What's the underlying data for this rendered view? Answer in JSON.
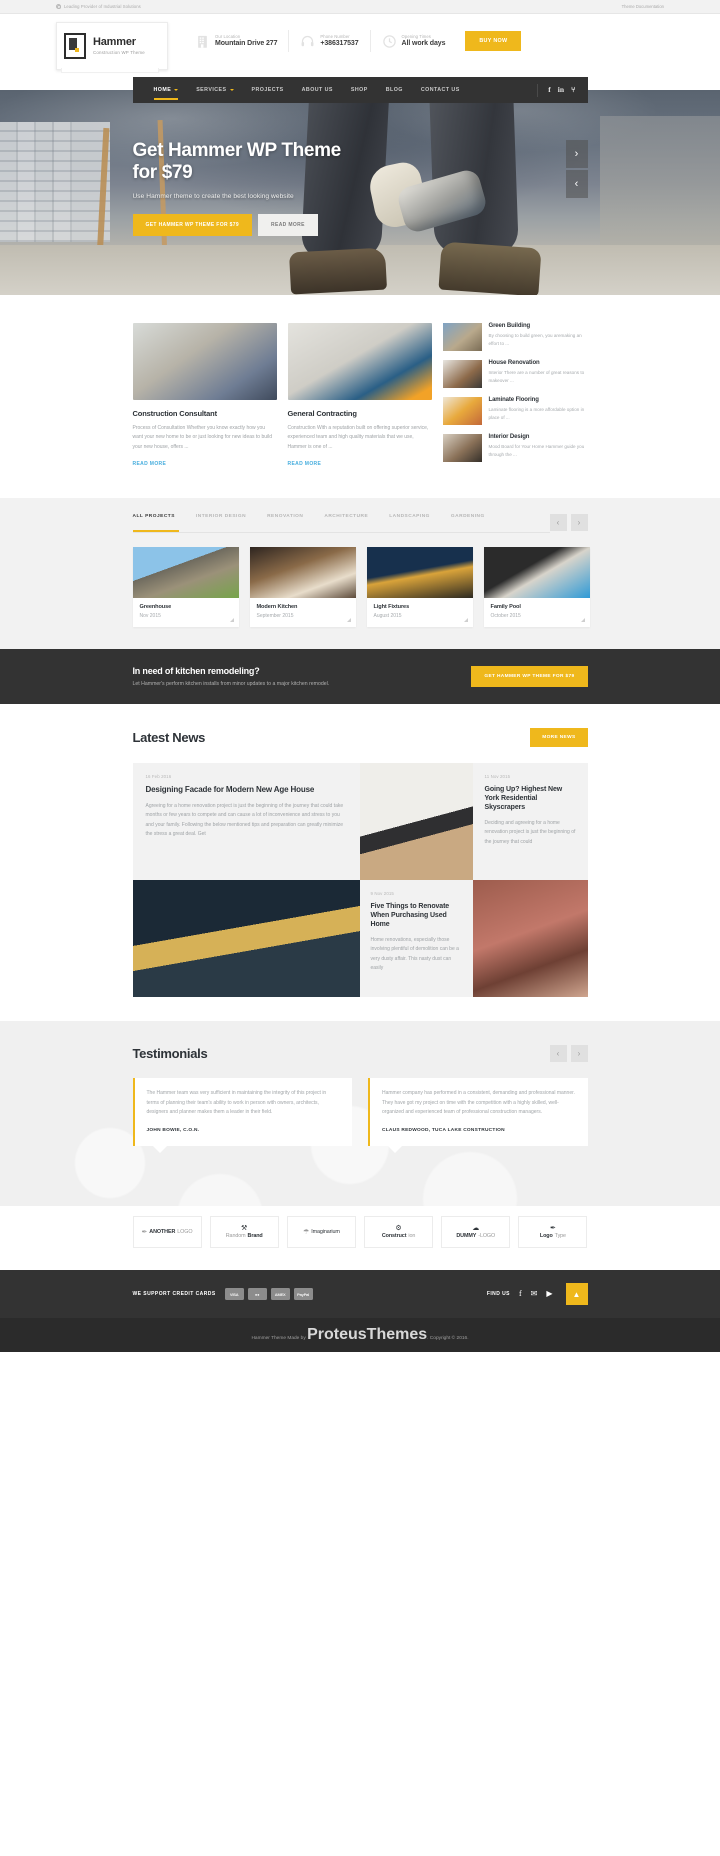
{
  "topbar": {
    "tagline": "Leading Provider of Industrial Solutions",
    "doc_link": "Theme Documentation"
  },
  "header": {
    "brand": "Hammer",
    "brand_sub": "Construction WP Theme",
    "info": [
      {
        "label": "Our Location",
        "value": "Mountain Drive 277",
        "icon": "building-icon"
      },
      {
        "label": "Phone Number",
        "value": "+386317537",
        "icon": "headset-icon"
      },
      {
        "label": "Opening Times",
        "value": "All work days",
        "icon": "clock-icon"
      }
    ],
    "buy_label": "BUY NOW"
  },
  "nav": {
    "items": [
      {
        "label": "HOME",
        "active": true,
        "caret": true
      },
      {
        "label": "SERVICES",
        "active": false,
        "caret": true
      },
      {
        "label": "PROJECTS",
        "active": false,
        "caret": false
      },
      {
        "label": "ABOUT US",
        "active": false,
        "caret": false
      },
      {
        "label": "SHOP",
        "active": false,
        "caret": false
      },
      {
        "label": "BLOG",
        "active": false,
        "caret": false
      },
      {
        "label": "CONTACT US",
        "active": false,
        "caret": false
      }
    ],
    "social": [
      "f",
      "in",
      "⑂"
    ]
  },
  "hero": {
    "title_line1": "Get Hammer WP Theme",
    "title_line2": "for $79",
    "subtitle": "Use Hammer theme to create the best looking website",
    "btn_primary": "GET HAMMER WP THEME FOR $79",
    "btn_secondary": "READ MORE",
    "next": "›",
    "prev": "‹"
  },
  "services": {
    "cards": [
      {
        "title": "Construction Consultant",
        "text": "Process of Consultation Whether you know exactly how you want your new home to be or just looking for new ideas to build your new house, offers ...",
        "more": "READ MORE"
      },
      {
        "title": "General Contracting",
        "text": "Construction With a reputation built on offering superior service, experienced team and high quality materials that we use, Hammer is one of ...",
        "more": "READ MORE"
      }
    ],
    "list": [
      {
        "title": "Green Building",
        "text": "By choosing to build green, you aremaking an effort to ..."
      },
      {
        "title": "House Renovation",
        "text": "Interior There are a number of great reasons to makeover ..."
      },
      {
        "title": "Laminate Flooring",
        "text": "Laminate flooring is a more affordable option in place of ..."
      },
      {
        "title": "Interior Design",
        "text": "Mood Board for Your Home Hammer guide you through the ..."
      }
    ]
  },
  "projects": {
    "filters": [
      "ALL PROJECTS",
      "INTERIOR DESIGN",
      "RENOVATION",
      "ARCHITECTURE",
      "LANDSCAPING",
      "GARDENING"
    ],
    "prev": "‹",
    "next": "›",
    "items": [
      {
        "name": "Greenhouse",
        "date": "Nov 2015"
      },
      {
        "name": "Modern Kitchen",
        "date": "September 2015"
      },
      {
        "name": "Light Fixtures",
        "date": "August 2015"
      },
      {
        "name": "Family Pool",
        "date": "October 2015"
      }
    ]
  },
  "cta": {
    "title": "In need of kitchen remodeling?",
    "subtitle": "Let Hammer's perform kitchen installs from minor updates to a major kitchen remodel.",
    "button": "GET HAMMER WP THEME FOR $79"
  },
  "news": {
    "title": "Latest News",
    "more_button": "MORE NEWS",
    "featured": {
      "date": "16 Feb 2016",
      "heading": "Designing Facade for Modern New Age House",
      "text": "Agreeing for a home renovation project is just the beginning of the journey that could take months or few years to compete and can cause a lot of inconvenience and stress to you and your family. Following the below mentioned tips and preparation can greatly minimize the stress a great deal. Get"
    },
    "side_top": {
      "date": "11 Nov 2015",
      "heading": "Going Up? Highest New York Residential Skyscrapers",
      "text": "Deciding and agreeing for a home renovation project is just the beginning of the journey that could"
    },
    "side_bottom": {
      "date": "9 Nov 2015",
      "heading": "Five Things to Renovate When Purchasing Used Home",
      "text": "Home renovations, especially those involving plentiful of demolition can be a very dusty affair. This nasty dust can easily"
    }
  },
  "testimonials": {
    "title": "Testimonials",
    "prev": "‹",
    "next": "›",
    "items": [
      {
        "quote": "The Hammer team was very sufficient in maintaining the integrity of this project in terms of planning their team's ability to work in person with owners, architects, designers and planner makes them a leader in their field.",
        "author": "JOHN BOWIE, C.O.N."
      },
      {
        "quote": "Hammer company has performed in a consistent, demanding and professional manner. They have got my project on time with the competition with a highly skilled, well-organized and experienced team of professional construction managers.",
        "author": "CLAUS REDWOOD, TUCA LAKE CONSTRUCTION"
      }
    ]
  },
  "brand_logos": [
    {
      "icon": "✒",
      "bold": "ANOTHER",
      "light": "LOGO",
      "stacked": false
    },
    {
      "icon": "⚒",
      "bold": "Brand",
      "light": "Random ",
      "stacked": true
    },
    {
      "icon": "☂",
      "bold": "",
      "light": "Imaginarium",
      "stacked": false
    },
    {
      "icon": "⚙",
      "bold": "Construct",
      "light": "ion",
      "stacked": true
    },
    {
      "icon": "☁",
      "bold": "DUMMY",
      "light": "-LOGO",
      "stacked": true
    },
    {
      "icon": "✒",
      "bold": "Logo",
      "light": "Type",
      "stacked": true
    }
  ],
  "footer": {
    "credit_label": "WE SUPPORT CREDIT CARDS",
    "cards": [
      "VISA",
      "●●",
      "AMEX",
      "PayPal"
    ],
    "find_us": "FIND US",
    "social": [
      "f",
      "✉",
      "▶"
    ],
    "to_top": "▲",
    "copyright_pre": "Hammer Theme Made by ",
    "copyright_brand": "ProteusThemes",
    "copyright_post": ". Copyright © 2016."
  }
}
